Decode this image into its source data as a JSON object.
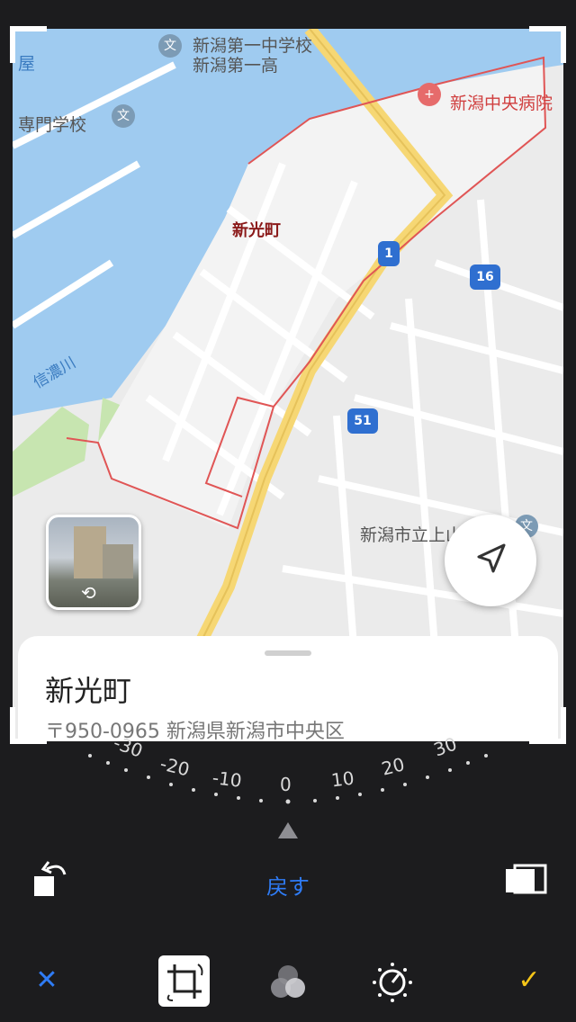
{
  "map": {
    "labels": {
      "school_1a": "新潟第一中学校",
      "school_1b": "新潟第一高",
      "station_fragment": "屋",
      "vocational": "専門学校",
      "hospital": "新潟中央病院",
      "district": "新光町",
      "river": "信濃川",
      "city_school": "新潟市立上山中"
    },
    "road_badges": [
      "1",
      "16",
      "51"
    ],
    "icons": {
      "school": "文",
      "hospital": "+",
      "train": "🚆"
    }
  },
  "info_card": {
    "title": "新光町",
    "address": "〒950-0965 新潟県新潟市中央区"
  },
  "dial": {
    "ticks": [
      "-30",
      "-20",
      "-10",
      "0",
      "10",
      "20",
      "30"
    ],
    "value": "0"
  },
  "toolbar": {
    "reset_label": "戻す",
    "cancel_symbol": "✕",
    "done_symbol": "✓"
  },
  "colors": {
    "accent_blue": "#2f7cf6",
    "done_yellow": "#f5c518",
    "water": "#9fcbf0",
    "road_major": "#f6d774",
    "park": "#c7e5b0",
    "boundary": "#e05555"
  }
}
